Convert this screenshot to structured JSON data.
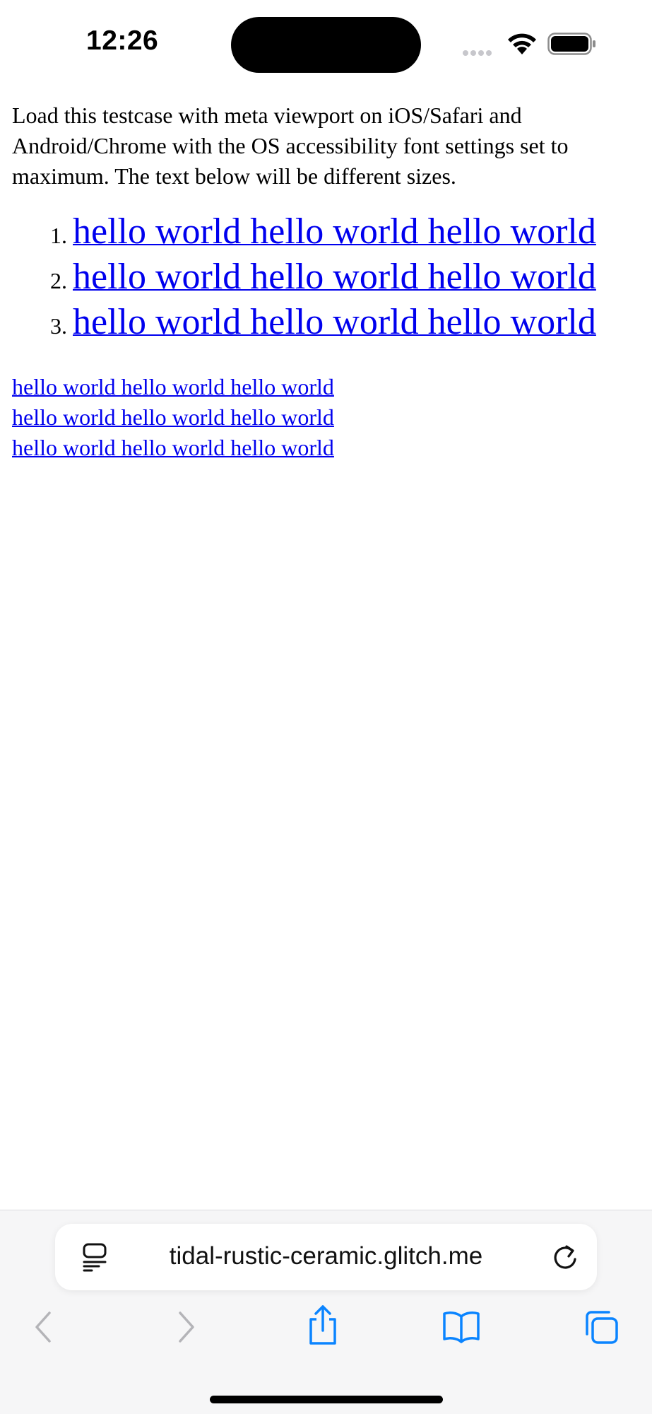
{
  "status_bar": {
    "time": "12:26"
  },
  "page": {
    "intro": "Load this testcase with meta viewport on iOS/Safari and Android/Chrome with the OS accessibility font settings set to maximum. The text below will be different sizes.",
    "list_items": [
      "hello world hello world hello world",
      "hello world hello world hello world",
      "hello world hello world hello world"
    ],
    "small_links": [
      "hello world hello world hello world",
      "hello world hello world hello world",
      "hello world hello world hello world"
    ]
  },
  "browser": {
    "url": "tidal-rustic-ceramic.glitch.me",
    "icons": {
      "reader": "reader-mode-icon",
      "reload": "reload-icon",
      "back": "chevron-left-icon",
      "forward": "chevron-right-icon",
      "share": "share-icon",
      "bookmarks": "book-icon",
      "tabs": "tabs-icon"
    }
  },
  "colors": {
    "link": "#0000ee",
    "toolbar_bg": "#f6f6f7",
    "accent": "#0a84ff",
    "disabled": "#b4b4b8"
  }
}
